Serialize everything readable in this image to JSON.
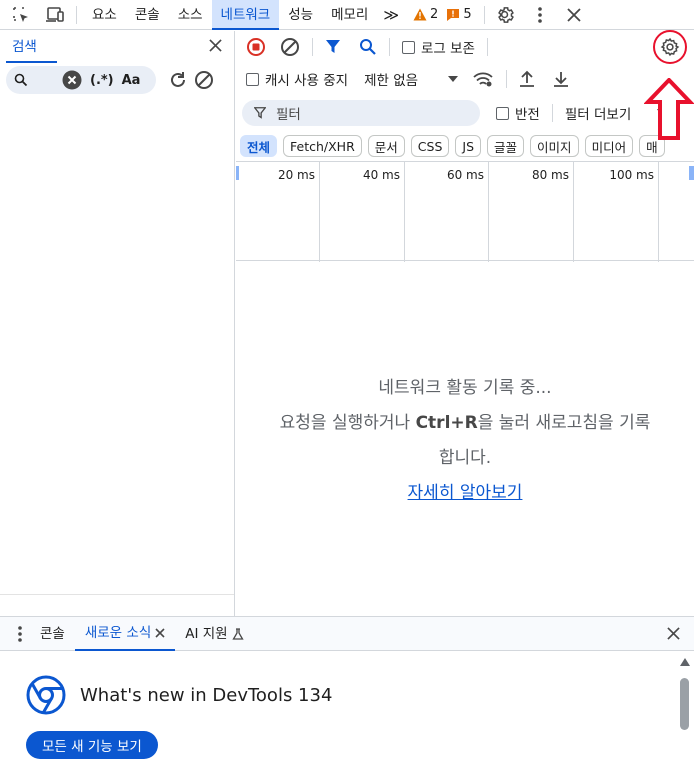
{
  "topbar": {
    "tabs": [
      "요소",
      "콘솔",
      "소스",
      "네트워크",
      "성능",
      "메모리"
    ],
    "more": "≫",
    "warnings": "2",
    "errors": "5"
  },
  "search_panel": {
    "title": "검색",
    "regex": "(.*)",
    "case": "Aa"
  },
  "network": {
    "preserve_log": "로그 보존",
    "disable_cache": "캐시 사용 중지",
    "throttle": "제한 없음",
    "filter_placeholder": "필터",
    "invert": "반전",
    "more_filters": "필터 더보기",
    "type_filters": [
      "전체",
      "Fetch/XHR",
      "문서",
      "CSS",
      "JS",
      "글꼴",
      "이미지",
      "미디어",
      "매"
    ],
    "timeline_ticks": [
      "20 ms",
      "40 ms",
      "60 ms",
      "80 ms",
      "100 ms"
    ],
    "empty_line1": "네트워크 활동 기록 중...",
    "empty_line2a": "요청을 실행하거나 ",
    "empty_shortcut": "Ctrl+R",
    "empty_line2b": "을 눌러 새로고침을 기록",
    "empty_line3": "합니다.",
    "learn_more": "자세히 알아보기"
  },
  "drawer": {
    "tabs": [
      "콘솔",
      "새로운 소식",
      "AI 지원"
    ],
    "whats_new_title": "What's new in DevTools 134",
    "see_all": "모든 새 기능 보기"
  },
  "colors": {
    "accent": "#0b57d0",
    "annotation": "#e8112d"
  }
}
